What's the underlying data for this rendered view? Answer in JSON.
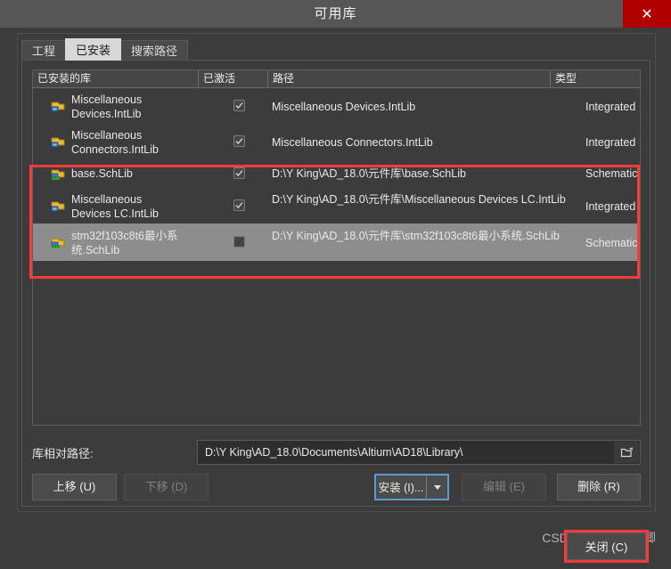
{
  "window": {
    "title": "可用库",
    "close_icon": "close-icon",
    "close_glyph": "✕",
    "accent_red": "#b00000",
    "annotation_red": "#fb3b3b",
    "selection_grey": "#8d8d8d",
    "focus_blue": "#5b9bd5"
  },
  "tabs": [
    {
      "label": "工程",
      "active": false
    },
    {
      "label": "已安装",
      "active": true
    },
    {
      "label": "搜索路径",
      "active": false
    }
  ],
  "list": {
    "columns": [
      {
        "key": "name",
        "label": "已安装的库"
      },
      {
        "key": "activated",
        "label": "已激活"
      },
      {
        "key": "path",
        "label": "路径"
      },
      {
        "key": "type",
        "label": "类型"
      }
    ],
    "rows": [
      {
        "name": "Miscellaneous Devices.IntLib",
        "activated": true,
        "path": "Miscellaneous Devices.IntLib",
        "type": "Integrated",
        "icon": "intlib-icon",
        "selected": false
      },
      {
        "name": "Miscellaneous Connectors.IntLib",
        "activated": true,
        "path": "Miscellaneous Connectors.IntLib",
        "type": "Integrated",
        "icon": "intlib-icon",
        "selected": false
      },
      {
        "name": "base.SchLib",
        "activated": true,
        "path": "D:\\Y King\\AD_18.0\\元件库\\base.SchLib",
        "type": "Schematic",
        "icon": "schlib-icon",
        "selected": false
      },
      {
        "name": "Miscellaneous Devices LC.IntLib",
        "activated": true,
        "path": "D:\\Y King\\AD_18.0\\元件库\\Miscellaneous Devices LC.IntLib",
        "type": "Integrated",
        "icon": "intlib-icon",
        "selected": false
      },
      {
        "name": "stm32f103c8t6最小系统.SchLib",
        "activated": true,
        "path": "D:\\Y King\\AD_18.0\\元件库\\stm32f103c8t6最小系统.SchLib",
        "type": "Schematic",
        "icon": "schlib-icon",
        "selected": true
      }
    ]
  },
  "relative_path": {
    "label": "库相对路径:",
    "value": "D:\\Y King\\AD_18.0\\Documents\\Altium\\AD18\\Library\\",
    "placeholder": "",
    "browse_icon": "folder-browse-icon"
  },
  "buttons": {
    "move_up": {
      "label": "上移 (U)",
      "enabled": true
    },
    "move_down": {
      "label": "下移 (D)",
      "enabled": false
    },
    "install": {
      "label": "安装 (I)...",
      "enabled": true,
      "has_dropdown": true,
      "dropdown_icon": "chevron-down-icon"
    },
    "edit": {
      "label": "编辑 (E)",
      "enabled": false
    },
    "delete": {
      "label": "删除 (R)",
      "enabled": true
    },
    "close": {
      "label": "关闭 (C)",
      "enabled": true
    }
  },
  "watermark": {
    "text": "CSDN @Coisini少卿"
  }
}
